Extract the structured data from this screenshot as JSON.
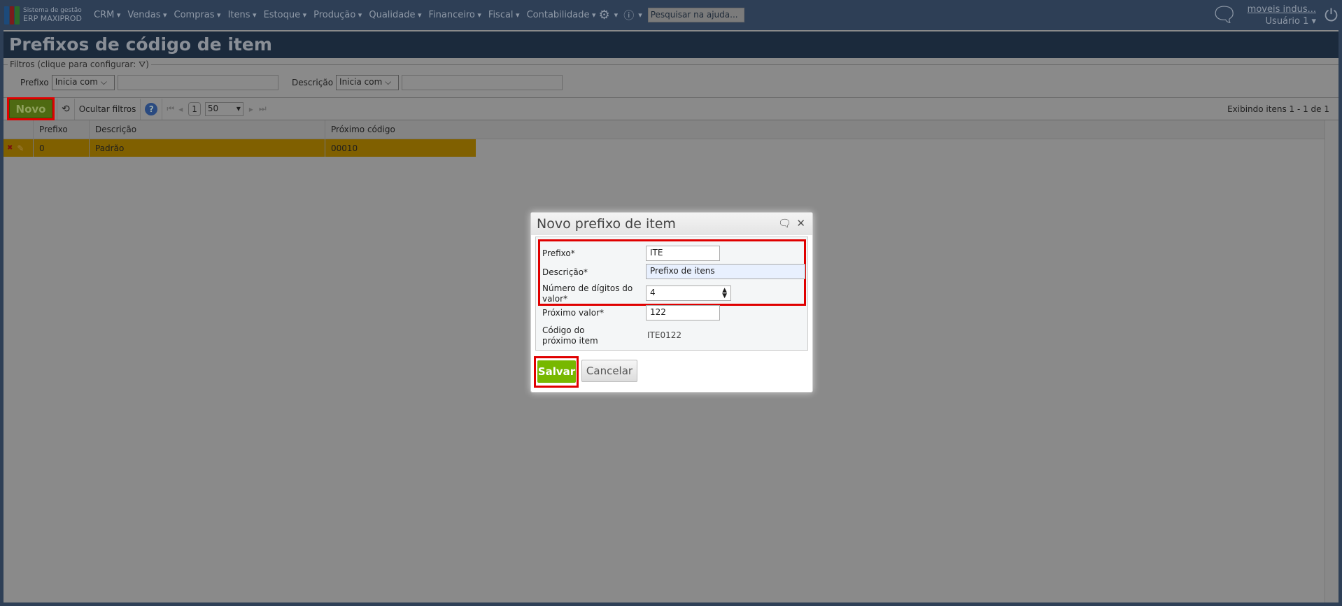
{
  "topbar": {
    "logo_line1": "Sistema de gestão",
    "logo_line2": "ERP MAXIPROD",
    "menu": [
      "CRM",
      "Vendas",
      "Compras",
      "Itens",
      "Estoque",
      "Produção",
      "Qualidade",
      "Financeiro",
      "Fiscal",
      "Contabilidade"
    ],
    "search_placeholder": "Pesquisar na ajuda...",
    "company": "moveis indus...",
    "user": "Usuário 1"
  },
  "page": {
    "title": "Prefixos de código de item"
  },
  "filters": {
    "legend": "Filtros (clique para configurar:",
    "legend_end": ")",
    "prefixo_label": "Prefixo",
    "prefixo_op": "Inicia com",
    "descricao_label": "Descrição",
    "descricao_op": "Inicia com"
  },
  "toolbar": {
    "novo": "Novo",
    "hide_filters": "Ocultar filtros",
    "page": "1",
    "page_size": "50",
    "status": "Exibindo itens 1 - 1 de 1"
  },
  "grid": {
    "columns": [
      "Prefixo",
      "Descrição",
      "Próximo código"
    ],
    "rows": [
      {
        "prefixo": "0",
        "descricao": "Padrão",
        "proximo": "00010"
      }
    ]
  },
  "dialog": {
    "title": "Novo prefixo de item",
    "prefixo_label": "Prefixo*",
    "prefixo_value": "ITE",
    "descricao_label": "Descrição*",
    "descricao_value": "Prefixo de itens",
    "digitos_label": "Número de dígitos do valor*",
    "digitos_value": "4",
    "proximo_label": "Próximo valor*",
    "proximo_value": "122",
    "codigo_label": "Código do próximo item",
    "codigo_value": "ITE0122",
    "save": "Salvar",
    "cancel": "Cancelar"
  }
}
